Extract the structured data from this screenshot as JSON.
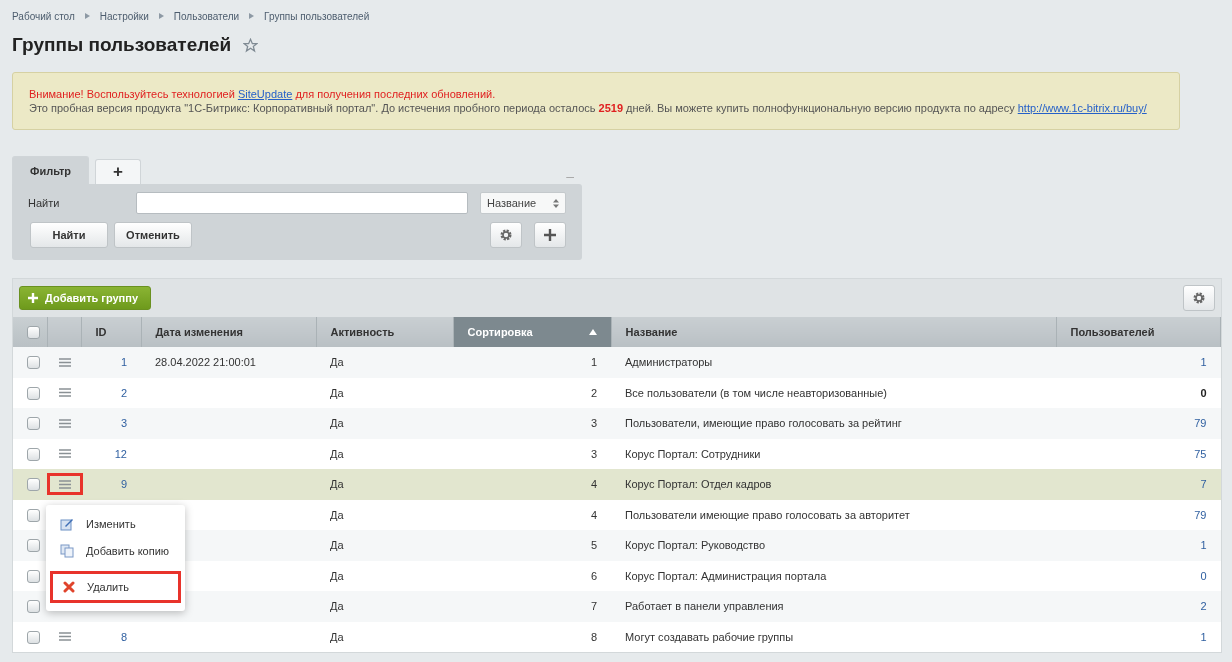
{
  "breadcrumbs": [
    "Рабочий стол",
    "Настройки",
    "Пользователи",
    "Группы пользователей"
  ],
  "title": "Группы пользователей",
  "favorite": false,
  "notice": {
    "warning_before": "Внимание! Воспользуйтесь технологией",
    "warning_link": "SiteUpdate",
    "warning_after": "для получения последних обновлений.",
    "info_before": "Это пробная версия продукта \"1С-Битрикс: Корпоративный портал\". До истечения пробного периода осталось",
    "days": "2519",
    "info_after": "дней. Вы можете купить полнофункциональную версию продукта по адресу",
    "link": "http://www.1c-bitrix.ru/buy/"
  },
  "filter": {
    "tabs": [
      {
        "label": "Фильтр",
        "selected": true
      },
      {
        "label": "+",
        "selected": false
      }
    ],
    "collapse": "–",
    "find_label": "Найти",
    "select": "Название",
    "buttons": [
      "Найти",
      "Отменить"
    ]
  },
  "toolbar": {
    "add_button": "Добавить группу"
  },
  "table": {
    "all_checked": false,
    "columns": [
      {
        "label": "ID",
        "sorted": false
      },
      {
        "label": "Дата изменения",
        "sorted": false
      },
      {
        "label": "Активность",
        "sorted": false
      },
      {
        "label": "Сортировка",
        "sorted": true
      },
      {
        "label": "Название",
        "sorted": false
      },
      {
        "label": "Пользователей",
        "sorted": false
      }
    ],
    "rows": [
      {
        "id": "1",
        "date": "28.04.2022 21:00:01",
        "active": "Да",
        "sort": "1",
        "name": "Администраторы",
        "users": "1",
        "linked": true,
        "selected": false,
        "checked": false,
        "menu_highlighted": false
      },
      {
        "id": "2",
        "active": "Да",
        "sort": "2",
        "name": "Все пользователи (в том числе неавторизованные)",
        "users": "0",
        "linked": false,
        "selected": false,
        "checked": false,
        "menu_highlighted": false
      },
      {
        "id": "3",
        "active": "Да",
        "sort": "3",
        "name": "Пользователи, имеющие право голосовать за рейтинг",
        "users": "79",
        "linked": true,
        "selected": false,
        "checked": false,
        "menu_highlighted": false
      },
      {
        "id": "12",
        "active": "Да",
        "sort": "3",
        "name": "Корус Портал: Сотрудники",
        "users": "75",
        "linked": true,
        "selected": false,
        "checked": false,
        "menu_highlighted": false
      },
      {
        "id": "9",
        "active": "Да",
        "sort": "4",
        "name": "Корус Портал: Отдел кадров",
        "users": "7",
        "linked": true,
        "selected": true,
        "checked": false,
        "menu_highlighted": true
      },
      {
        "active": "Да",
        "sort": "4",
        "name": "Пользователи имеющие право голосовать за авторитет",
        "users": "79",
        "linked": true,
        "selected": false,
        "checked": false
      },
      {
        "active": "Да",
        "sort": "5",
        "name": "Корус Портал: Руководство",
        "users": "1",
        "linked": true,
        "selected": false,
        "checked": false
      },
      {
        "active": "Да",
        "sort": "6",
        "name": "Корус Портал: Администрация портала",
        "users": "0",
        "linked": true,
        "selected": false,
        "checked": false
      },
      {
        "active": "Да",
        "sort": "7",
        "name": "Работает в панели управления",
        "users": "2",
        "linked": true,
        "selected": false,
        "checked": false
      },
      {
        "id": "8",
        "active": "Да",
        "sort": "8",
        "name": "Могут создавать рабочие группы",
        "users": "1",
        "linked": true,
        "selected": false,
        "checked": false,
        "menu_highlighted": false
      }
    ]
  },
  "context_menu": {
    "items": [
      {
        "kind": "edit",
        "label": "Изменить",
        "highlighted": false
      },
      {
        "kind": "copy",
        "label": "Добавить копию",
        "highlighted": false
      },
      {
        "kind": "delete",
        "label": "Удалить",
        "highlighted": true
      }
    ]
  }
}
